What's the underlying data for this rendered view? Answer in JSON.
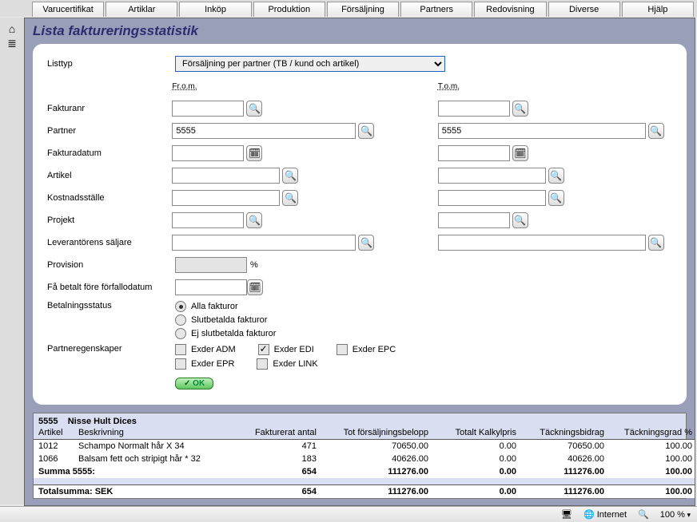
{
  "tabs": [
    "Varucertifikat",
    "Artiklar",
    "Inköp",
    "Produktion",
    "Försäljning",
    "Partners",
    "Redovisning",
    "Diverse",
    "Hjälp"
  ],
  "page_title": "Lista faktureringsstatistik",
  "form": {
    "labels": {
      "listtype": "Listtyp",
      "from": "Fr.o.m.",
      "to": "T.o.m.",
      "fakturanr": "Fakturanr",
      "partner": "Partner",
      "fakturadatum": "Fakturadatum",
      "artikel": "Artikel",
      "kostnadsstalle": "Kostnadsställe",
      "projekt": "Projekt",
      "leverantor": "Leverantörens säljare",
      "provision": "Provision",
      "percent": "%",
      "fa_betalt": "Få betalt före förfallodatum",
      "betalning": "Betalningsstatus",
      "partneregenskaper": "Partneregenskaper"
    },
    "listtype_selected": "Försäljning per partner (TB / kund och artikel)",
    "partner_from": "5555",
    "partner_to": "5555",
    "radios": {
      "alla": "Alla fakturor",
      "slut": "Slutbetalda fakturor",
      "ejslut": "Ej slutbetalda fakturor",
      "selected": "alla"
    },
    "checks": {
      "adm": {
        "label": "Exder ADM",
        "checked": false
      },
      "edi": {
        "label": "Exder EDI",
        "checked": true
      },
      "epc": {
        "label": "Exder EPC",
        "checked": false
      },
      "epr": {
        "label": "Exder EPR",
        "checked": false
      },
      "link": {
        "label": "Exder LINK",
        "checked": false
      }
    },
    "ok_label": "OK"
  },
  "results": {
    "partner_id": "5555",
    "partner_name": "Nisse Hult Dices",
    "columns": {
      "artikel": "Artikel",
      "beskrivning": "Beskrivning",
      "antal": "Fakturerat antal",
      "belopp": "Tot försäljningsbelopp",
      "kalkylpris": "Totalt Kalkylpris",
      "tb": "Täckningsbidrag",
      "tg": "Täckningsgrad %"
    },
    "rows": [
      {
        "artikel": "1012",
        "beskrivning": "Schampo Normalt hår X 34",
        "antal": "471",
        "belopp": "70650.00",
        "kalkylpris": "0.00",
        "tb": "70650.00",
        "tg": "100.00"
      },
      {
        "artikel": "1066",
        "beskrivning": "Balsam fett och stripigt hår * 32",
        "antal": "183",
        "belopp": "40626.00",
        "kalkylpris": "0.00",
        "tb": "40626.00",
        "tg": "100.00"
      }
    ],
    "sum_label": "Summa  5555:",
    "sum": {
      "antal": "654",
      "belopp": "111276.00",
      "kalkylpris": "0.00",
      "tb": "111276.00",
      "tg": "100.00"
    },
    "grand_label": "Totalsumma: SEK",
    "grand": {
      "antal": "654",
      "belopp": "111276.00",
      "kalkylpris": "0.00",
      "tb": "111276.00",
      "tg": "100.00"
    }
  },
  "statusbar": {
    "zone": "Internet",
    "zoom": "100 %"
  }
}
